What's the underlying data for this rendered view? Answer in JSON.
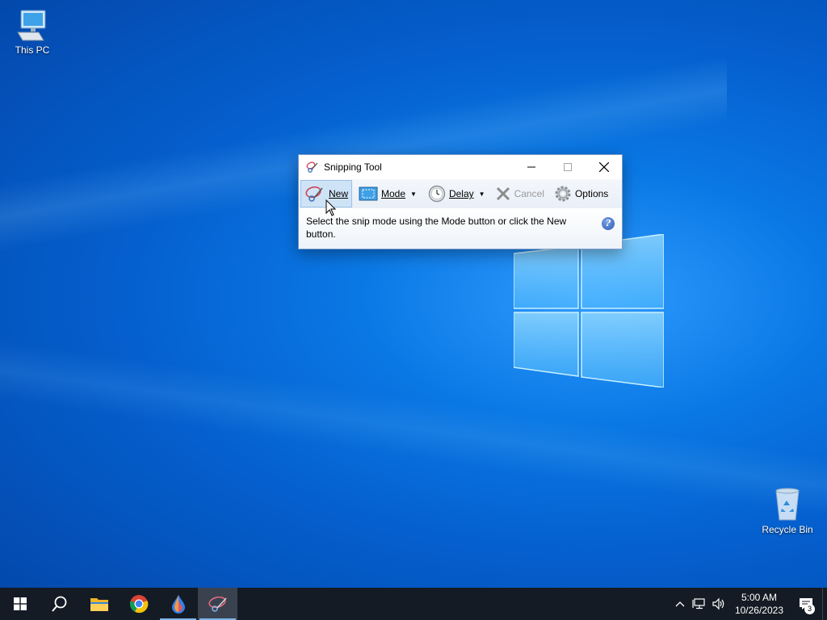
{
  "desktop": {
    "icons": [
      {
        "label": "This PC",
        "icon": "computer-icon"
      },
      {
        "label": "Recycle Bin",
        "icon": "recycle-bin-icon"
      }
    ]
  },
  "window": {
    "title": "Snipping Tool",
    "controls": {
      "minimize": "minimize-icon",
      "maximize": "maximize-icon",
      "close": "close-icon"
    },
    "toolbar": {
      "new_label": "New",
      "mode_label": "Mode",
      "delay_label": "Delay",
      "cancel_label": "Cancel",
      "options_label": "Options"
    },
    "message": "Select the snip mode using the Mode button or click the New button.",
    "help_glyph": "?"
  },
  "taskbar": {
    "apps": [
      {
        "name": "start",
        "icon": "windows-start-icon"
      },
      {
        "name": "search",
        "icon": "search-icon"
      },
      {
        "name": "file-explorer",
        "icon": "folder-icon"
      },
      {
        "name": "chrome",
        "icon": "chrome-icon"
      },
      {
        "name": "paint",
        "icon": "drop-icon"
      },
      {
        "name": "snipping-tool",
        "icon": "scissors-icon"
      }
    ],
    "clock": {
      "time": "5:00 AM",
      "date": "10/26/2023"
    },
    "notification_count": "3"
  },
  "colors": {
    "accent": "#0078d7",
    "taskbar": "#141b24"
  }
}
